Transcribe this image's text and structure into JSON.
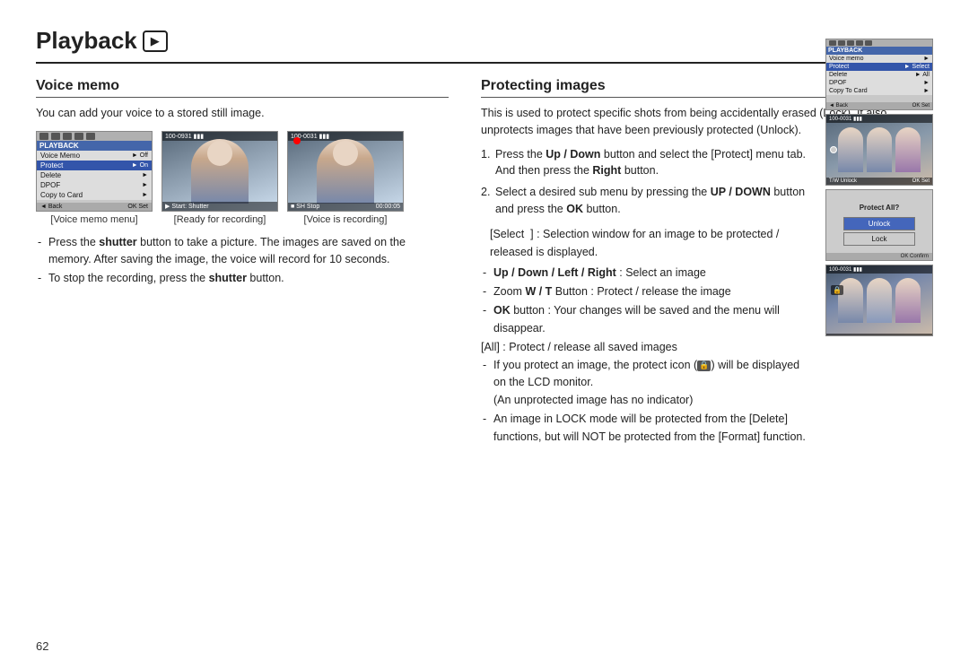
{
  "page": {
    "title": "Playback",
    "page_number": "62"
  },
  "voice_memo": {
    "section_title": "Voice memo",
    "description": "You can add your voice to a stored still image.",
    "images": [
      {
        "caption": "[Voice memo menu]"
      },
      {
        "caption": "[Ready for recording]"
      },
      {
        "caption": "[Voice is recording]"
      }
    ],
    "menu_items": [
      {
        "label": "Voice Memo",
        "value": "Off",
        "highlight": false
      },
      {
        "label": "Protect",
        "value": "On",
        "highlight": true
      },
      {
        "label": "Delete",
        "value": "",
        "highlight": false
      },
      {
        "label": "DPOF",
        "value": "",
        "highlight": false
      },
      {
        "label": "Copy to Card",
        "value": "",
        "highlight": false
      }
    ],
    "menu_label": "PLAYBACK",
    "bottom_back": "◄ Back",
    "bottom_ok": "OK Set",
    "bullet1": "Press the shutter button to take a picture. The images are saved on the memory. After saving the image, the voice will record for 10 seconds.",
    "bullet2": "To stop the recording, press the shutter button.",
    "shutter_bold": "shutter",
    "shutter_bold2": "shutter"
  },
  "protecting_images": {
    "section_title": "Protecting images",
    "description": "This is used to protect specific shots from being accidentally erased (Lock). It also unprotects images that have been previously protected (Unlock).",
    "step1": "Press the Up / Down button and select the [Protect] menu tab. And then press the Right button.",
    "step1_bold_up_down": "Up / Down",
    "step1_bold_right": "Right",
    "step2": "Select a desired sub menu by pressing the UP / DOWN button and press the OK button.",
    "step2_bold_updown": "UP / DOWN",
    "step2_bold_ok": "OK",
    "select_block": "[Select ] : Selection window for an image to be protected / released is displayed.",
    "sub_bullet1_label": "Up / Down / Left / Right",
    "sub_bullet1_rest": " : Select an image",
    "sub_bullet2": "Zoom W / T Button : Protect / release the image",
    "sub_bullet2_bold_wt": "W / T",
    "sub_bullet3": "OK button : Your changes will be saved and the menu will disappear.",
    "sub_bullet3_bold_ok": "OK",
    "all_block": "[All] : Protect / release all saved images",
    "protect_bullet1": "If you protect an image, the protect icon (",
    "protect_bullet1_icon": "🔒",
    "protect_bullet1_rest": ") will be displayed on the LCD monitor.",
    "protect_bullet1_note": "(An unprotected image has no indicator)",
    "protect_bullet2": "An image in LOCK mode will be protected from the [Delete] functions, but will NOT be protected from the [Format] function.",
    "menu_label2": "PLAYBACK",
    "menu_items2": [
      {
        "label": "Voice memo",
        "value": "",
        "highlight": false
      },
      {
        "label": "Protect",
        "value": "Select",
        "highlight": true
      },
      {
        "label": "Delete",
        "value": "All",
        "highlight": false
      },
      {
        "label": "DPOF",
        "value": "",
        "highlight": false
      },
      {
        "label": "Copy To Card",
        "value": "",
        "highlight": false
      }
    ],
    "bottom_back2": "◄ Back",
    "bottom_ok2": "OK Set",
    "image_number": "100-0031",
    "image_number2": "100-0031",
    "tw_unlock": "T/W  Unlock",
    "ok_set": "OK  Set",
    "protect_all_label": "Protect All?",
    "unlock_btn": "Unlock",
    "lock_btn": "Lock",
    "ok_confirm": "OK  Confirm"
  }
}
